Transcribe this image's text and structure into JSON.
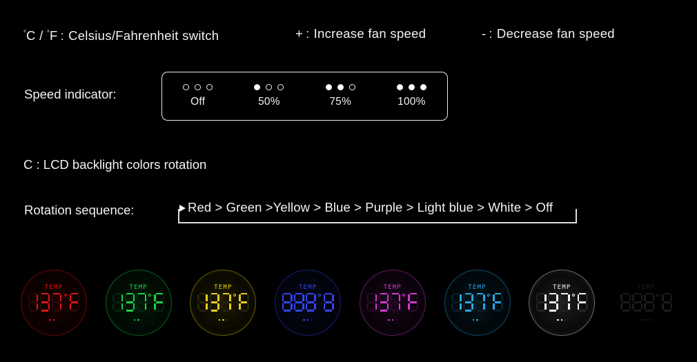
{
  "legend": {
    "items": [
      {
        "key": "°C / °F",
        "sep": ":",
        "desc": "Celsius/Fahrenheit switch",
        "name": "legend-temp-unit"
      },
      {
        "key": "+",
        "sep": ":",
        "desc": "Increase fan speed",
        "name": "legend-increase"
      },
      {
        "key": "-",
        "sep": ":",
        "desc": "Decrease fan speed",
        "name": "legend-decrease"
      }
    ],
    "temp_unit_c": "C",
    "temp_unit_slash": " / ",
    "temp_unit_f": "F",
    "temp_unit_sep": ":",
    "temp_unit_desc": "Celsius/Fahrenheit switch",
    "increase_key": "+",
    "increase_sep": ":",
    "increase_desc": "Increase fan speed",
    "decrease_key": "-",
    "decrease_sep": ":",
    "decrease_desc": "Decrease fan speed"
  },
  "speed": {
    "label": "Speed indicator:",
    "steps": [
      {
        "label": "Off",
        "dots": [
          "hollow",
          "hollow",
          "hollow"
        ]
      },
      {
        "label": "50%",
        "dots": [
          "filled",
          "hollow",
          "hollow"
        ]
      },
      {
        "label": "75%",
        "dots": [
          "filled",
          "filled",
          "hollow"
        ]
      },
      {
        "label": "100%",
        "dots": [
          "filled",
          "filled",
          "filled"
        ]
      }
    ]
  },
  "backlight": {
    "heading": "C : LCD backlight colors rotation",
    "heading_key": "C",
    "heading_sep": ":",
    "heading_desc": "LCD backlight colors rotation"
  },
  "rotation": {
    "label": "Rotation sequence:",
    "sequence_text": "Red > Green >Yellow > Blue > Purple > Light blue > White > Off",
    "sequence": [
      "Red",
      "Green",
      "Yellow",
      "Blue",
      "Purple",
      "Light blue",
      "White",
      "Off"
    ],
    "separator": ">",
    "loop_line_color": "#dcdcdc",
    "arrow_color": "#ffffff"
  },
  "lcd_displays": [
    {
      "color_name": "Red",
      "color": "#e01414",
      "dim_color": "#2a0808",
      "temp_label": "TEMP",
      "value": "137",
      "unit": "F",
      "degree": true,
      "digits": [
        "1",
        "3",
        "7"
      ],
      "backlight_on": true
    },
    {
      "color_name": "Green",
      "color": "#1ad148",
      "dim_color": "#07230f",
      "temp_label": "TEMP",
      "value": "137",
      "unit": "F",
      "degree": true,
      "digits": [
        "1",
        "3",
        "7"
      ],
      "backlight_on": true
    },
    {
      "color_name": "Yellow",
      "color": "#e8cf18",
      "dim_color": "#272208",
      "temp_label": "TEMP",
      "value": "137",
      "unit": "F",
      "degree": true,
      "digits": [
        "1",
        "3",
        "7"
      ],
      "backlight_on": true
    },
    {
      "color_name": "Blue",
      "color": "#3344e8",
      "dim_color": "#0b0e2b",
      "temp_label": "TEMP",
      "value": "888",
      "unit": "8",
      "degree": true,
      "digits": [
        "8",
        "8",
        "8"
      ],
      "backlight_on": true
    },
    {
      "color_name": "Purple",
      "color": "#d23ad2",
      "dim_color": "#260a26",
      "temp_label": "TEMP",
      "value": "137",
      "unit": "F",
      "degree": true,
      "digits": [
        "1",
        "3",
        "7"
      ],
      "backlight_on": true
    },
    {
      "color_name": "Light blue",
      "color": "#25a8e8",
      "dim_color": "#081e2b",
      "temp_label": "TEMP",
      "value": "137",
      "unit": "F",
      "degree": true,
      "digits": [
        "1",
        "3",
        "7"
      ],
      "backlight_on": true
    },
    {
      "color_name": "White",
      "color": "#f2f2f2",
      "dim_color": "#242424",
      "temp_label": "TEMP",
      "value": "137",
      "unit": "F",
      "degree": true,
      "digits": [
        "1",
        "3",
        "7"
      ],
      "backlight_on": true
    },
    {
      "color_name": "Off",
      "color": "#1e1a18",
      "dim_color": "#161311",
      "temp_label": "TEMP",
      "value": "888",
      "unit": "8",
      "degree": true,
      "digits": [
        "8",
        "8",
        "8"
      ],
      "backlight_on": false
    }
  ],
  "theme": {
    "background": "#000000",
    "text": "#f2f2f2",
    "outline": "#e9e9e9"
  }
}
